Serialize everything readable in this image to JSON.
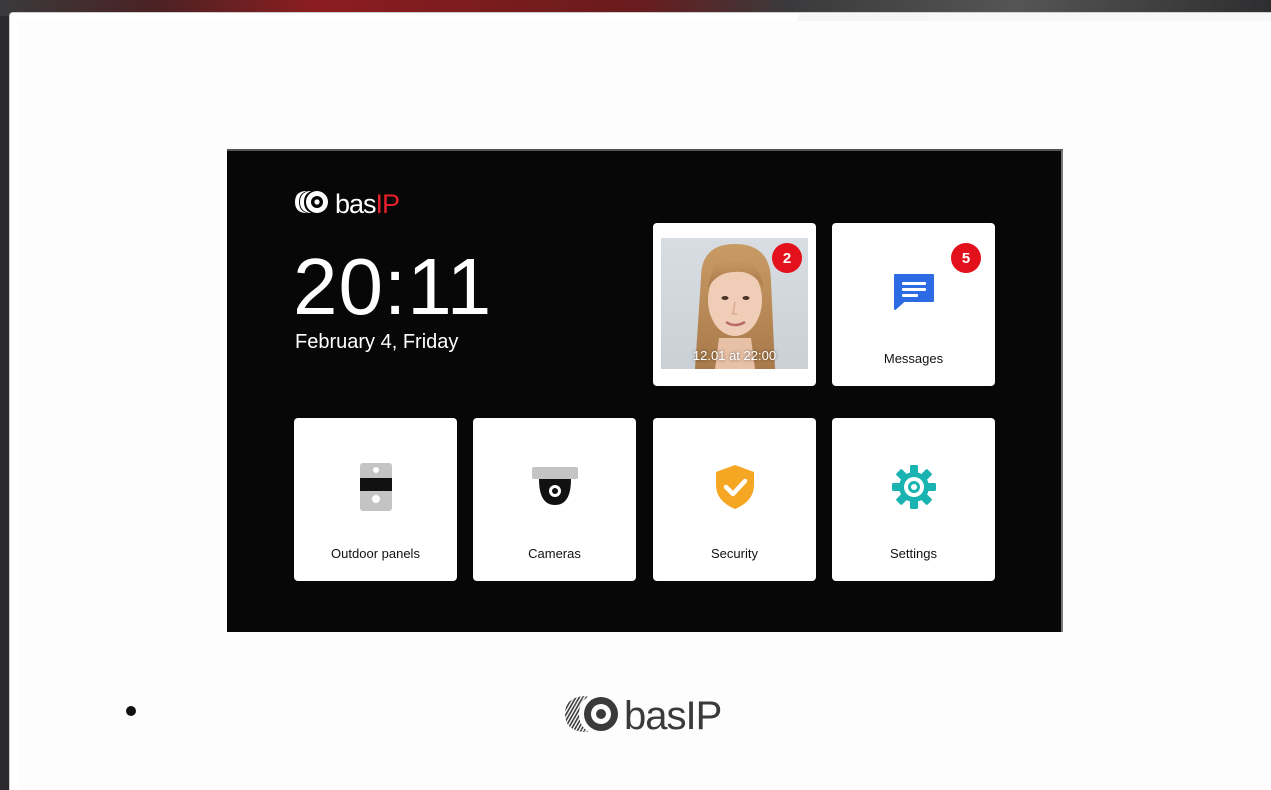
{
  "brand": {
    "name_bas": "bas",
    "name_ip": "IP",
    "accent": "#e3202a"
  },
  "status": {
    "time": "20:11",
    "date": "February 4, Friday"
  },
  "tiles": {
    "call_log": {
      "timestamp": "12.01 at 22:00",
      "badge": "2"
    },
    "messages": {
      "label": "Messages",
      "badge": "5"
    },
    "outdoor_panels": {
      "label": "Outdoor panels"
    },
    "cameras": {
      "label": "Cameras"
    },
    "security": {
      "label": "Security"
    },
    "settings": {
      "label": "Settings"
    }
  },
  "colors": {
    "badge": "#e3111c",
    "messages_icon": "#2d6be4",
    "security_icon": "#f5a623",
    "settings_icon": "#19b3b1"
  },
  "icons": {
    "messages": "chat-bubble-icon",
    "outdoor_panels": "intercom-panel-icon",
    "cameras": "dome-camera-icon",
    "security": "shield-check-icon",
    "settings": "gear-icon"
  }
}
